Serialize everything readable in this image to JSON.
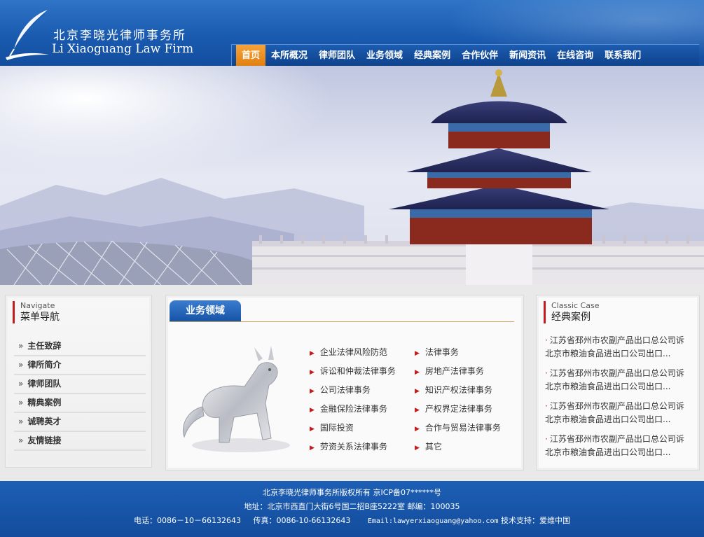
{
  "header": {
    "logo_cn": "北京李晓光律师事务所",
    "logo_en": "Li Xiaoguang Law Firm",
    "nav": [
      {
        "label": "首页",
        "active": true
      },
      {
        "label": "本所概况"
      },
      {
        "label": "律师团队"
      },
      {
        "label": "业务领域"
      },
      {
        "label": "经典案例"
      },
      {
        "label": "合作伙伴"
      },
      {
        "label": "新闻资讯"
      },
      {
        "label": "在线咨询"
      },
      {
        "label": "联系我们"
      }
    ]
  },
  "left_menu": {
    "title_en": "Navigate",
    "title_cn": "菜单导航",
    "items": [
      "主任致辞",
      "律所简介",
      "律师团队",
      "精典案例",
      "诚聘英才",
      "友情链接"
    ]
  },
  "services": {
    "tab_label": "业务领域",
    "items": [
      [
        "企业法律风险防范",
        "法律事务"
      ],
      [
        "诉讼和仲裁法律事务",
        "房地产法律事务"
      ],
      [
        "公司法律事务",
        "知识产权法律事务"
      ],
      [
        "金融保险法律事务",
        "产权界定法律事务"
      ],
      [
        "国际投资",
        "合作与贸易法律事务"
      ],
      [
        "劳资关系法律事务",
        "其它"
      ]
    ]
  },
  "cases": {
    "title_en": "Classic Case",
    "title_cn": "经典案例",
    "items": [
      {
        "line1": "江苏省邳州市农副产品出口总公司诉",
        "line2": "北京市粮油食品进出口公司出口..."
      },
      {
        "line1": "江苏省邳州市农副产品出口总公司诉",
        "line2": "北京市粮油食品进出口公司出口..."
      },
      {
        "line1": "江苏省邳州市农副产品出口总公司诉",
        "line2": "北京市粮油食品进出口公司出口..."
      },
      {
        "line1": "江苏省邳州市农副产品出口总公司诉",
        "line2": "北京市粮油食品进出口公司出口..."
      }
    ]
  },
  "footer": {
    "copyright": "北京李晓光律师事务所版权所有 京ICP备07******号",
    "address": "地址：北京市西直门大街6号国二招B座5222室 邮编：100035",
    "phone": "电话：0086－10－66132643",
    "fax": "传真：0086-10-66132643",
    "email": "Email:lawyerxiaoguang@yahoo.com",
    "support": "技术支持：爱维中国"
  },
  "colors": {
    "header_blue": "#1a5bb0",
    "nav_active": "#f0921f",
    "accent_red": "#c21c1c",
    "footer_blue": "#1d5fb5"
  }
}
